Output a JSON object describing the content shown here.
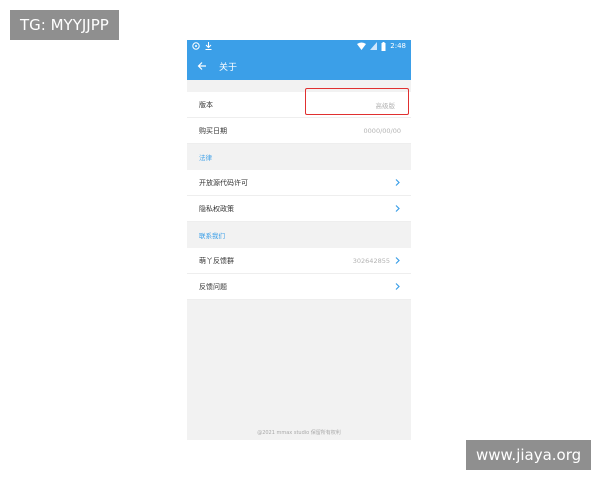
{
  "watermarks": {
    "top_left": "TG: MYYJJPP",
    "bottom_right": "www.jiaya.org"
  },
  "statusbar": {
    "time": "2:48",
    "left_icons": [
      "notification-icon",
      "download-icon"
    ],
    "right_icons": [
      "wifi-icon",
      "signal-icon",
      "battery-icon"
    ]
  },
  "appbar": {
    "title": "关于",
    "back_icon": "arrow-left-icon"
  },
  "version": {
    "label": "版本",
    "value": "高级版"
  },
  "purchase": {
    "label": "购买日期",
    "value": "0000/00/00"
  },
  "legal": {
    "header": "法律",
    "items": [
      {
        "label": "开放源代码许可"
      },
      {
        "label": "隐私权政策"
      }
    ]
  },
  "contact": {
    "header": "联系我们",
    "items": [
      {
        "label": "萌丫反馈群",
        "value": "302642855"
      },
      {
        "label": "反馈问题",
        "value": ""
      }
    ]
  },
  "footer": {
    "text": "@2021 mmax studio 保留所有权利"
  },
  "colors": {
    "accent": "#3b9fe8",
    "highlight": "#e03030",
    "background": "#f2f2f2"
  }
}
